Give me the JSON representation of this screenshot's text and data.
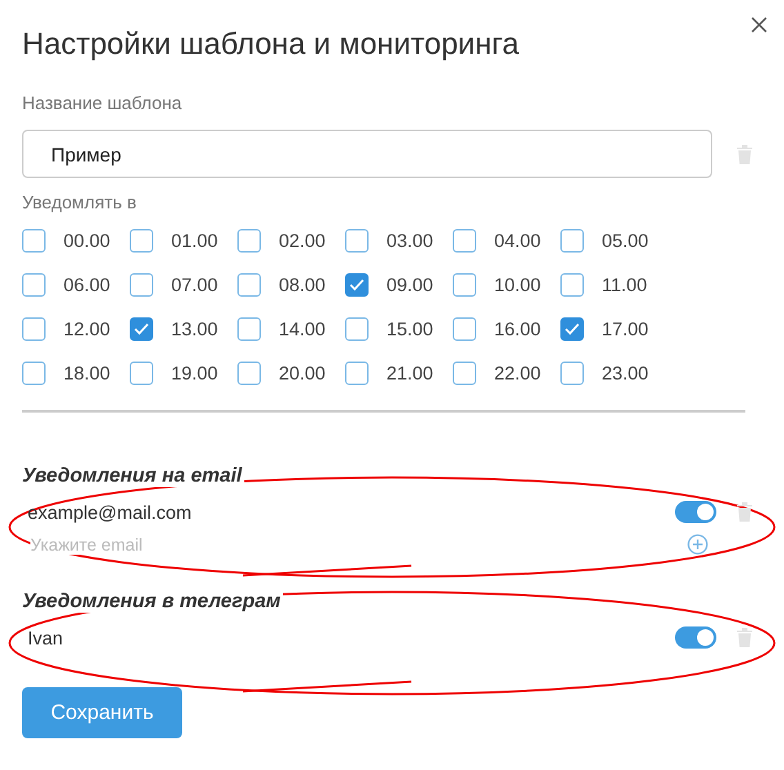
{
  "dialog": {
    "title": "Настройки шаблона и мониторинга"
  },
  "template_name": {
    "label": "Название шаблона",
    "value": "Пример"
  },
  "notify_label": "Уведомлять в",
  "hours": [
    {
      "label": "00.00",
      "checked": false
    },
    {
      "label": "01.00",
      "checked": false
    },
    {
      "label": "02.00",
      "checked": false
    },
    {
      "label": "03.00",
      "checked": false
    },
    {
      "label": "04.00",
      "checked": false
    },
    {
      "label": "05.00",
      "checked": false
    },
    {
      "label": "06.00",
      "checked": false
    },
    {
      "label": "07.00",
      "checked": false
    },
    {
      "label": "08.00",
      "checked": false
    },
    {
      "label": "09.00",
      "checked": true
    },
    {
      "label": "10.00",
      "checked": false
    },
    {
      "label": "11.00",
      "checked": false
    },
    {
      "label": "12.00",
      "checked": false
    },
    {
      "label": "13.00",
      "checked": true
    },
    {
      "label": "14.00",
      "checked": false
    },
    {
      "label": "15.00",
      "checked": false
    },
    {
      "label": "16.00",
      "checked": false
    },
    {
      "label": "17.00",
      "checked": true
    },
    {
      "label": "18.00",
      "checked": false
    },
    {
      "label": "19.00",
      "checked": false
    },
    {
      "label": "20.00",
      "checked": false
    },
    {
      "label": "21.00",
      "checked": false
    },
    {
      "label": "22.00",
      "checked": false
    },
    {
      "label": "23.00",
      "checked": false
    }
  ],
  "sections": [
    {
      "title": "Уведомления на email",
      "items": [
        {
          "value": "example@mail.com",
          "on": true
        }
      ],
      "placeholder": "Укажите email"
    },
    {
      "title": "Уведомления в телеграм",
      "items": [
        {
          "value": "Ivan",
          "on": true
        }
      ]
    }
  ],
  "save_button": "Сохранить"
}
